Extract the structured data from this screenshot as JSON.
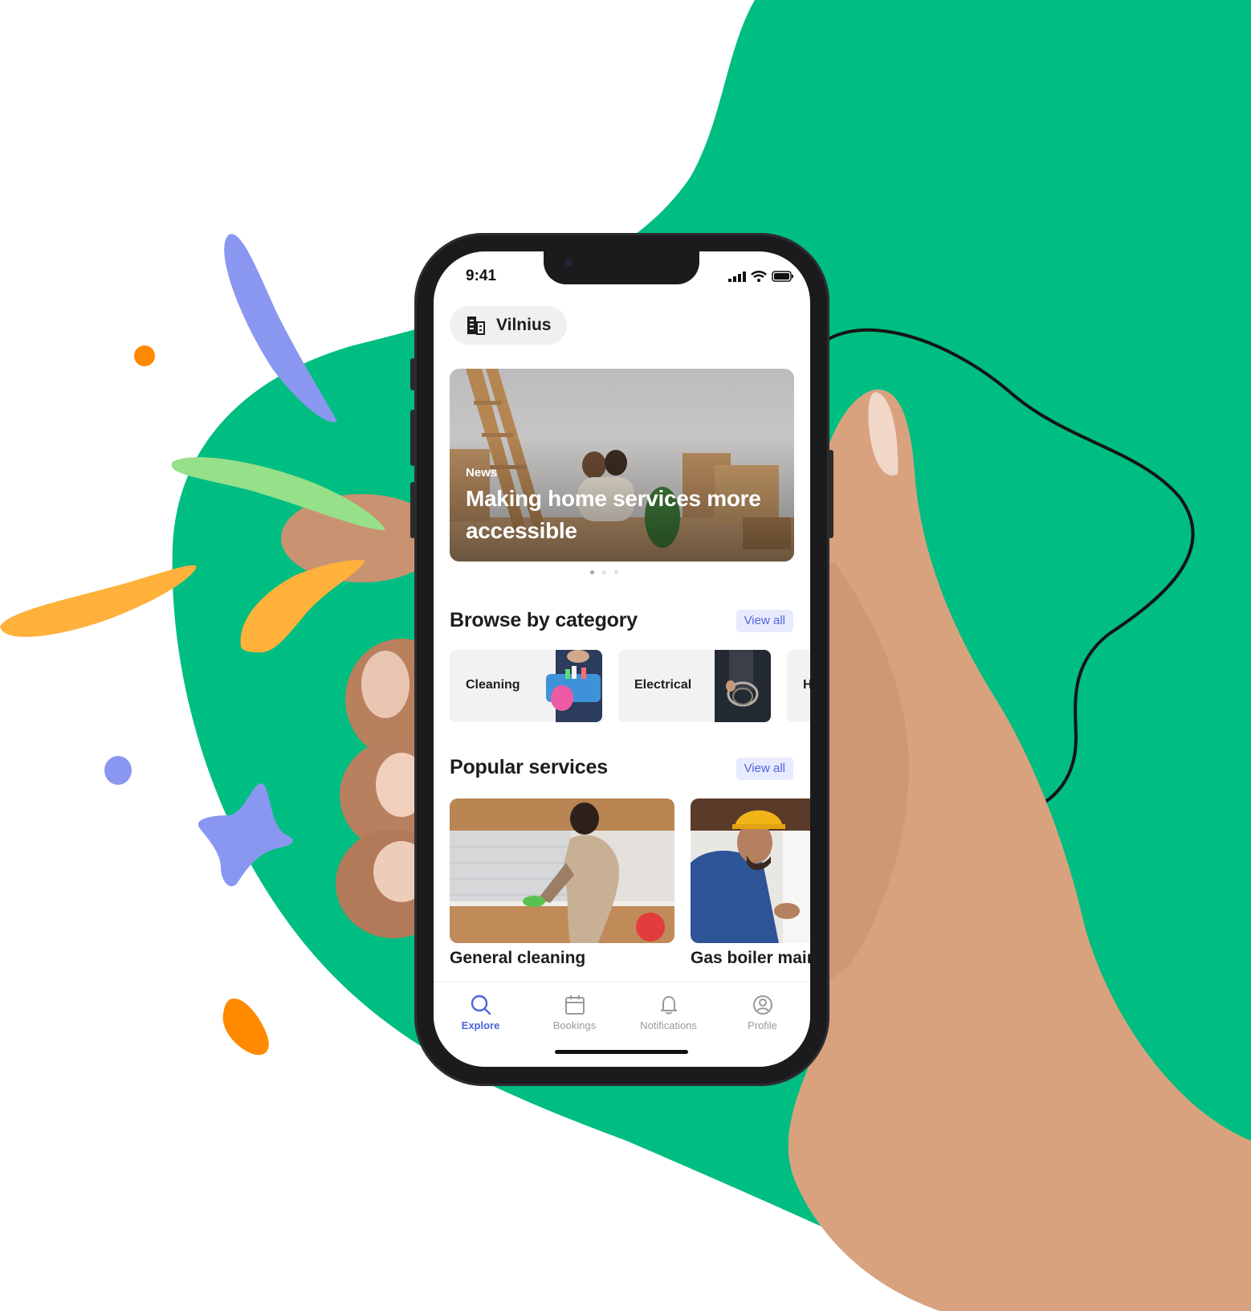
{
  "status_bar": {
    "time": "9:41"
  },
  "location": {
    "label": "Vilnius",
    "icon": "building-icon"
  },
  "banner": {
    "tag": "News",
    "headline": "Making home services more accessible"
  },
  "carousel": {
    "count": 3,
    "active": 0
  },
  "categories_section": {
    "title": "Browse by category",
    "view_all": "View all",
    "items": [
      {
        "label": "Cleaning"
      },
      {
        "label": "Electrical"
      },
      {
        "label": "H"
      }
    ]
  },
  "services_section": {
    "title": "Popular services",
    "view_all": "View all",
    "items": [
      {
        "label": "General cleaning"
      },
      {
        "label": "Gas boiler main"
      }
    ]
  },
  "tabbar": {
    "items": [
      {
        "label": "Explore",
        "icon": "search-icon",
        "active": true
      },
      {
        "label": "Bookings",
        "icon": "calendar-icon",
        "active": false
      },
      {
        "label": "Notifications",
        "icon": "bell-icon",
        "active": false
      },
      {
        "label": "Profile",
        "icon": "user-circle-icon",
        "active": false
      }
    ]
  },
  "colors": {
    "green_blob": "#00bd81",
    "accent": "#4d63de",
    "view_all_bg": "#e8eafe",
    "orange": "#ff8a00",
    "yellow": "#ffb13b",
    "lavender": "#8a97f0",
    "light_green": "#96e08a"
  }
}
